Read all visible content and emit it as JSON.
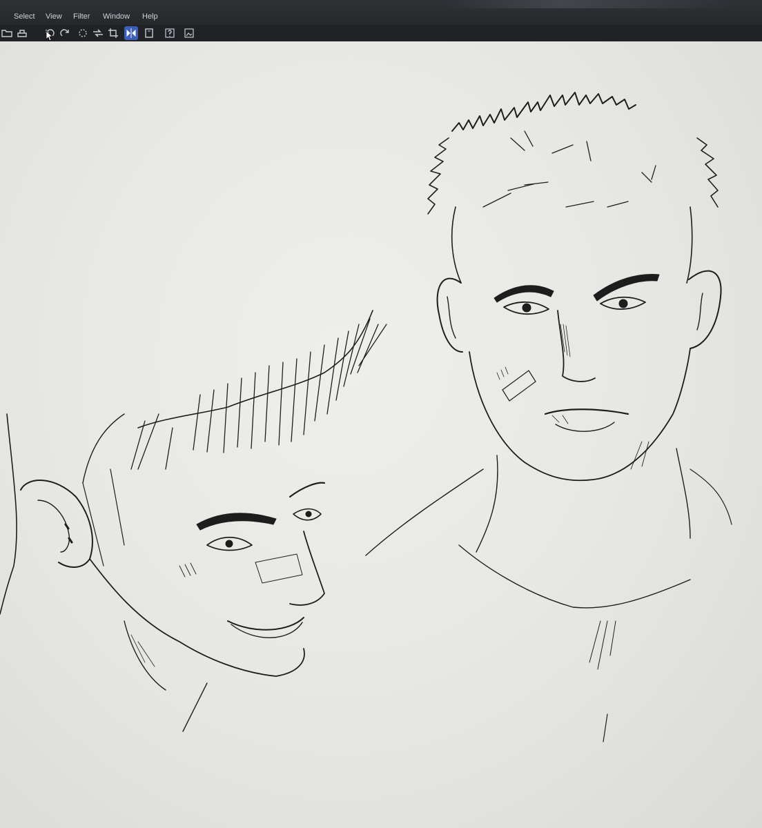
{
  "menu": {
    "items": [
      {
        "label": "Select"
      },
      {
        "label": "View"
      },
      {
        "label": "Filter"
      },
      {
        "label": "Window"
      },
      {
        "label": "Help"
      }
    ]
  },
  "toolbar": {
    "tools": [
      {
        "icon": "folder-open-icon"
      },
      {
        "icon": "save-icon"
      },
      {
        "icon": "undo-icon"
      },
      {
        "icon": "redo-icon"
      },
      {
        "icon": "loading-icon"
      },
      {
        "icon": "transfer-icon"
      },
      {
        "icon": "crop-icon"
      },
      {
        "icon": "flip-icon",
        "active": true
      },
      {
        "icon": "guide-icon"
      },
      {
        "icon": "help-icon"
      },
      {
        "icon": "image-icon"
      }
    ]
  },
  "colors": {
    "menubar": "#2f3136",
    "toolbar": "#202226",
    "canvas": "#eeeeea",
    "ink": "#1b1b1b",
    "active_tool": "#3b5fb5"
  }
}
